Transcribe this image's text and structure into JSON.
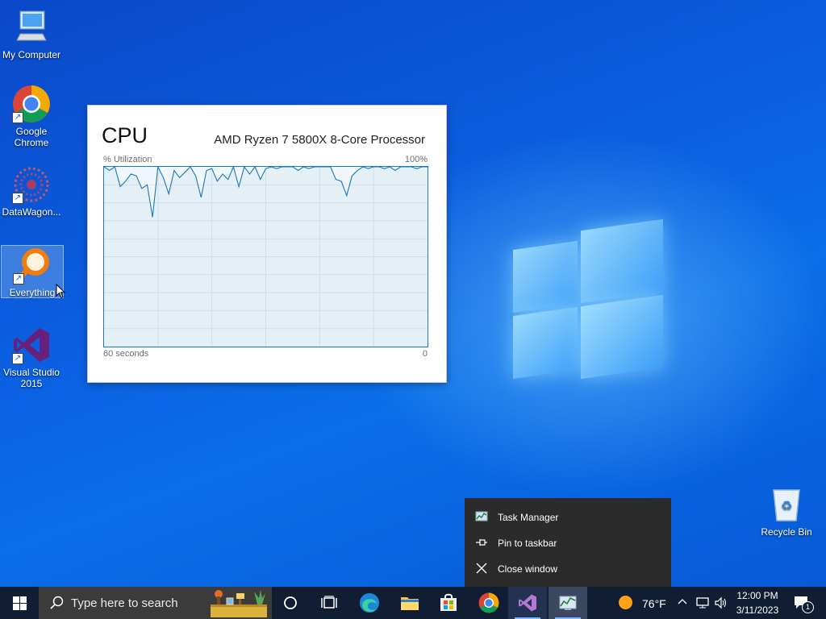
{
  "desktop": {
    "icons": [
      {
        "label": "My Computer"
      },
      {
        "label": "Google Chrome"
      },
      {
        "label": "DataWagon..."
      },
      {
        "label": "Everything"
      },
      {
        "label": "Visual Studio 2015"
      },
      {
        "label": "Recycle Bin"
      }
    ]
  },
  "cpu_window": {
    "title": "CPU",
    "processor": "AMD Ryzen 7 5800X 8-Core Processor",
    "y_label": "% Utilization",
    "y_max": "100%",
    "x_min_label": "60 seconds",
    "x_max_label": "0"
  },
  "chart_data": {
    "type": "line",
    "title": "CPU",
    "ylabel": "% Utilization",
    "ylim": [
      0,
      100
    ],
    "x": [
      60,
      59,
      58,
      57,
      56,
      55,
      54,
      53,
      52,
      51,
      50,
      49,
      48,
      47,
      46,
      45,
      44,
      43,
      42,
      41,
      40,
      39,
      38,
      37,
      36,
      35,
      34,
      33,
      32,
      31,
      30,
      29,
      28,
      27,
      26,
      25,
      24,
      23,
      22,
      21,
      20,
      19,
      18,
      17,
      16,
      15,
      14,
      13,
      12,
      11,
      10,
      9,
      8,
      7,
      6,
      5,
      4,
      3,
      2,
      1,
      0
    ],
    "series": [
      {
        "values": [
          100,
          98,
          100,
          89,
          92,
          96,
          95,
          88,
          90,
          72,
          100,
          94,
          85,
          98,
          94,
          97,
          100,
          95,
          83,
          98,
          99,
          92,
          96,
          93,
          100,
          89,
          100,
          96,
          100,
          93,
          99,
          100,
          99,
          100,
          100,
          100,
          98,
          100,
          99,
          100,
          100,
          100,
          100,
          93,
          92,
          84,
          95,
          98,
          100,
          99,
          100,
          100,
          99,
          100,
          98,
          100,
          100,
          100,
          99,
          100,
          100
        ]
      }
    ]
  },
  "context_menu": {
    "items": [
      {
        "label": "Task Manager",
        "icon": "task-manager-icon"
      },
      {
        "label": "Pin to taskbar",
        "icon": "pin-icon"
      },
      {
        "label": "Close window",
        "icon": "close-icon"
      }
    ]
  },
  "taskbar": {
    "search_placeholder": "Type here to search",
    "weather": "76°F",
    "time": "12:00 PM",
    "date": "3/11/2023",
    "notification_count": "1"
  },
  "colors": {
    "graph_line": "#1779ba",
    "taskbar": "#101d33",
    "menu_bg": "#2b2b2b"
  }
}
